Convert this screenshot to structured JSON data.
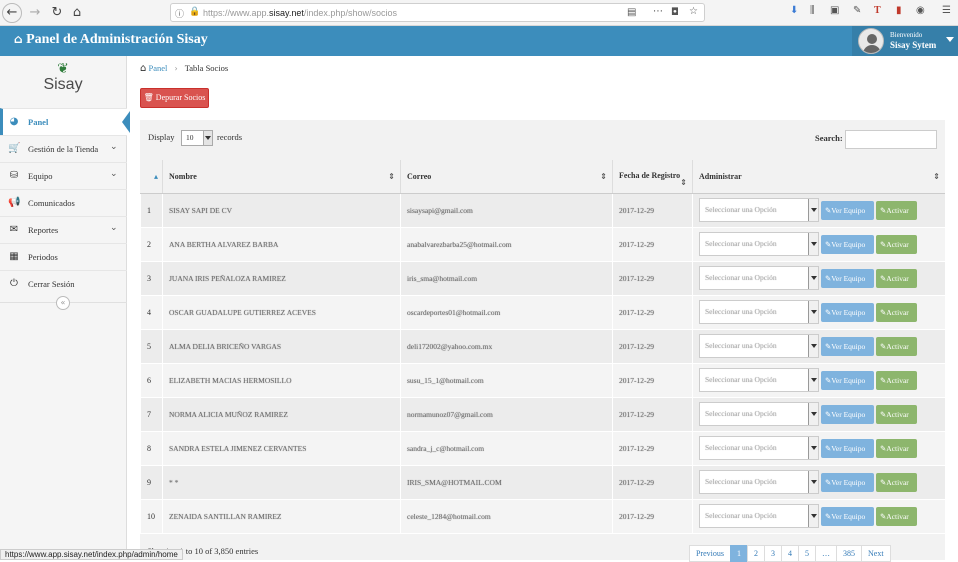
{
  "browser": {
    "url_prefix": "https://www.app.",
    "url_domain": "sisay.net",
    "url_path": "/index.php/show/socios"
  },
  "header": {
    "title": "Panel de Administración Sisay",
    "welcome": "Bienvenido",
    "user_name": "Sisay Sytem"
  },
  "sidebar": {
    "logo_text": "Sisay",
    "items": [
      {
        "label": "Panel",
        "icon": "dashboard-icon"
      },
      {
        "label": "Gestión de la Tienda",
        "icon": "cart-icon"
      },
      {
        "label": "Equipo",
        "icon": "sitemap-icon"
      },
      {
        "label": "Comunicados",
        "icon": "bullhorn-icon"
      },
      {
        "label": "Reportes",
        "icon": "report-icon"
      },
      {
        "label": "Periodos",
        "icon": "calendar-icon"
      },
      {
        "label": "Cerrar Sesión",
        "icon": "power-icon"
      }
    ]
  },
  "breadcrumb": {
    "home": "Panel",
    "current": "Tabla Socios"
  },
  "toolbar": {
    "depurar_label": "Depurar Socios"
  },
  "table_controls": {
    "display_label": "Display",
    "length_value": "10",
    "records_label": "records",
    "search_label": "Search:"
  },
  "table": {
    "headers": [
      "Nombre",
      "Correo",
      "Fecha de Registro",
      "Administrar"
    ],
    "select_placeholder": "Seleccionar una Opción",
    "ver_label": "Ver Equipo",
    "activar_label": "Activar",
    "rows": [
      {
        "n": "1",
        "nombre": "SISAY SAPI DE CV",
        "correo": "sisaysapi@gmail.com",
        "fecha": "2017-12-29"
      },
      {
        "n": "2",
        "nombre": "ANA BERTHA ALVAREZ BARBA",
        "correo": "anabalvarezbarba25@hotmail.com",
        "fecha": "2017-12-29"
      },
      {
        "n": "3",
        "nombre": "JUANA IRIS PEÑALOZA RAMIREZ",
        "correo": "iris_sma@hotmail.com",
        "fecha": "2017-12-29"
      },
      {
        "n": "4",
        "nombre": "OSCAR GUADALUPE GUTIERREZ ACEVES",
        "correo": "oscardeportes01@hotmail.com",
        "fecha": "2017-12-29"
      },
      {
        "n": "5",
        "nombre": "ALMA DELIA BRICEÑO VARGAS",
        "correo": "deli172002@yahoo.com.mx",
        "fecha": "2017-12-29"
      },
      {
        "n": "6",
        "nombre": "ELIZABETH MACIAS HERMOSILLO",
        "correo": "susu_15_1@hotmail.com",
        "fecha": "2017-12-29"
      },
      {
        "n": "7",
        "nombre": "NORMA ALICIA MUÑOZ RAMIREZ",
        "correo": "normamunoz07@gmail.com",
        "fecha": "2017-12-29"
      },
      {
        "n": "8",
        "nombre": "SANDRA ESTELA JIMENEZ CERVANTES",
        "correo": "sandra_j_c@hotmail.com",
        "fecha": "2017-12-29"
      },
      {
        "n": "9",
        "nombre": "* *",
        "correo": "IRIS_SMA@HOTMAIL.COM",
        "fecha": "2017-12-29"
      },
      {
        "n": "10",
        "nombre": "ZENAIDA SANTILLAN RAMIREZ",
        "correo": "celeste_1284@hotmail.com",
        "fecha": "2017-12-29"
      }
    ]
  },
  "footer": {
    "info": "Showing 1 to 10 of 3,850 entries",
    "pages": [
      "Previous",
      "1",
      "2",
      "3",
      "4",
      "5",
      "…",
      "385",
      "Next"
    ],
    "current_page": "1"
  },
  "status_bar": "https://www.app.sisay.net/index.php/admin/home"
}
